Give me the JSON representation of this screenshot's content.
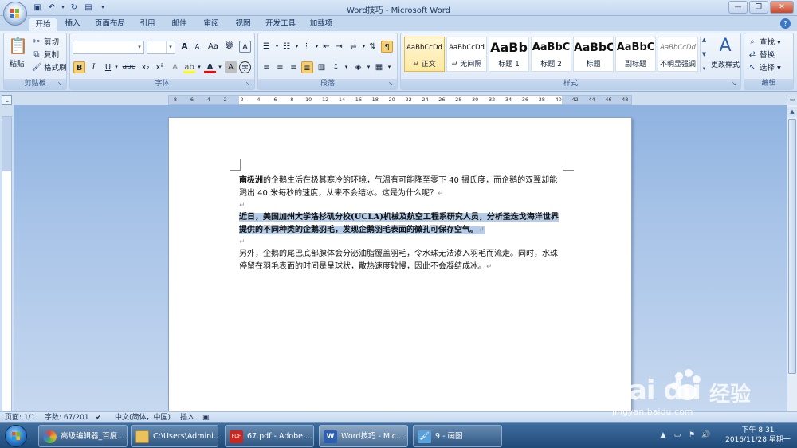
{
  "window": {
    "title": "Word技巧 - Microsoft Word",
    "controls": [
      "minimize",
      "maximize",
      "close"
    ]
  },
  "quick_access": [
    "save-icon",
    "undo-icon",
    "redo-icon",
    "print-preview-icon"
  ],
  "ribbon_tabs": [
    "开始",
    "插入",
    "页面布局",
    "引用",
    "邮件",
    "审阅",
    "视图",
    "开发工具",
    "加载项"
  ],
  "active_tab": "开始",
  "clipboard": {
    "label": "剪贴板",
    "paste": "粘贴",
    "cut": "剪切",
    "copy": "复制",
    "format_painter": "格式刷"
  },
  "font": {
    "label": "字体",
    "font_name": "",
    "font_size": "",
    "bold": "B",
    "italic": "I",
    "underline": "U",
    "strikethrough": "abe",
    "subscript": "x₂",
    "superscript": "x²",
    "change_case": "Aa",
    "grow": "A",
    "shrink": "A",
    "clear": "A",
    "font_color": "A",
    "highlight_color": "#ffff00",
    "font_color_value": "#ff0000"
  },
  "paragraph": {
    "label": "段落"
  },
  "styles": {
    "label": "样式",
    "items": [
      {
        "sample": "AaBbCcDd",
        "name": "↵ 正文"
      },
      {
        "sample": "AaBbCcDd",
        "name": "↵ 无间隔"
      },
      {
        "sample": "AaBb",
        "name": "标题 1"
      },
      {
        "sample": "AaBbC",
        "name": "标题 2"
      },
      {
        "sample": "AaBbC",
        "name": "标题"
      },
      {
        "sample": "AaBbC",
        "name": "副标题"
      },
      {
        "sample": "AaBbCcDd",
        "name": "不明显强调"
      }
    ],
    "change_styles": "更改样式"
  },
  "editing": {
    "label": "编辑",
    "find": "查找 ▾",
    "replace": "替换",
    "select": "选择 ▾"
  },
  "ruler_ticks": [
    "8",
    "6",
    "4",
    "2",
    "2",
    "4",
    "6",
    "8",
    "10",
    "12",
    "14",
    "16",
    "18",
    "20",
    "22",
    "24",
    "26",
    "28",
    "30",
    "32",
    "34",
    "36",
    "38",
    "40",
    "42",
    "44",
    "46",
    "48"
  ],
  "document": {
    "p1_bold": "南极洲",
    "p1_rest": "的企鹅生活在极其寒冷的环境，气温有可能降至零下 40 摄氏度，而企鹅的双翼却能溅出 40 米每秒的速度，从来不会结冰。这是为什么呢？",
    "p2": "近日，美国加州大学洛杉矶分校(UCLA)机械及航空工程系研究人员，分析圣迭戈海洋世界提供的不同种类的企鹅羽毛，发现企鹅羽毛表面的微孔可保存空气。",
    "p3": "另外，企鹅的尾巴底部腺体会分泌油脂覆盖羽毛，令水珠无法渗入羽毛而流走。同时，水珠停留在羽毛表面的时间是呈球状，散热速度较慢，因此不会凝结成冰。",
    "para_mark": "↵"
  },
  "statusbar": {
    "page": "页面: 1/1",
    "words": "字数: 67/201",
    "language": "中文(简体，中国)",
    "insert": "插入"
  },
  "taskbar": {
    "items": [
      {
        "label": "高级编辑器_百度...",
        "color": "#e04a3a"
      },
      {
        "label": "C:\\Users\\Admini...",
        "color": "#e8c25a"
      },
      {
        "label": "67.pdf - Adobe ...",
        "color": "#c8281e"
      },
      {
        "label": "Word技巧 - Mic...",
        "color": "#2b5fb2"
      },
      {
        "label": "9 - 画图",
        "color": "#5aa0d8"
      }
    ],
    "time": "下午 8:31",
    "date": "2016/11/28 星期一"
  },
  "watermark": {
    "brand": "Bai  du",
    "jingyan": "经验",
    "url": "jingyan.baidu.com"
  }
}
